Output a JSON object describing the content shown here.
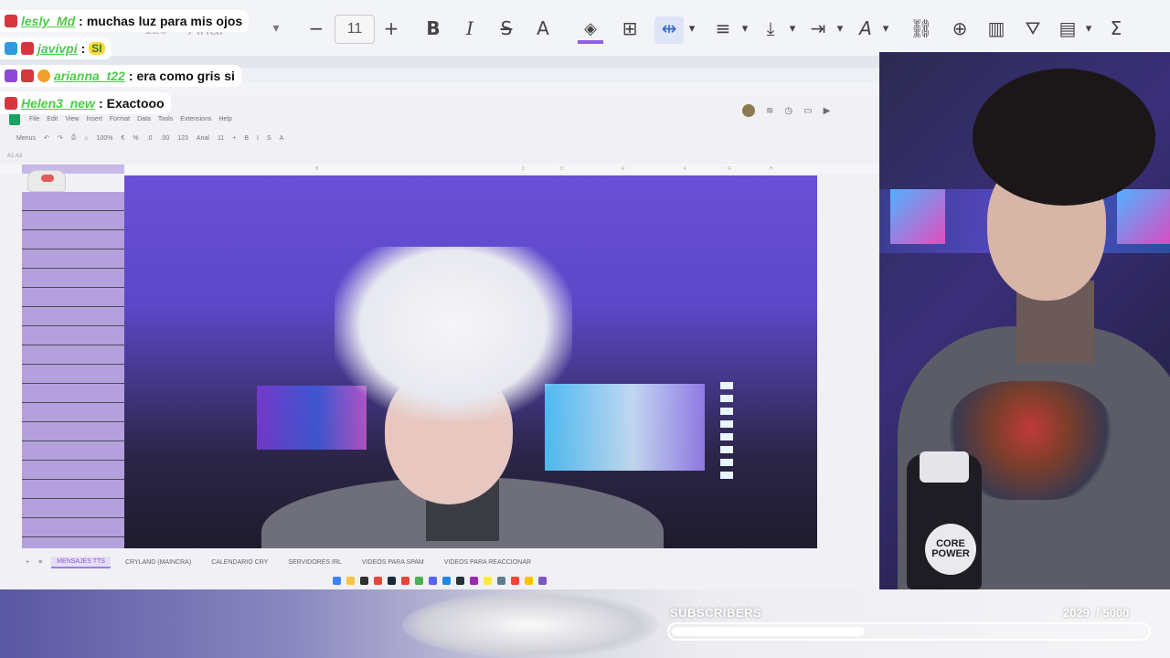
{
  "toolbar": {
    "zoom_partial": "120",
    "font_name": "Arial",
    "font_size": "11",
    "icons": [
      "minus-icon",
      "plus-icon",
      "bold-icon",
      "italic-icon",
      "strikethrough-icon",
      "text-color-icon",
      "fill-color-icon",
      "borders-icon",
      "merge-cells-icon",
      "horizontal-align-icon",
      "vertical-align-icon",
      "text-wrap-icon",
      "text-rotation-icon",
      "link-icon",
      "comment-icon",
      "chart-icon",
      "filter-icon",
      "table-view-icon",
      "functions-icon"
    ],
    "bold": "B",
    "italic": "I",
    "strike": "S",
    "text_color": "A",
    "rotate": "A",
    "sigma": "Σ",
    "accent": "#8e60e6"
  },
  "sheets": {
    "menu": [
      "File",
      "Edit",
      "View",
      "Insert",
      "Format",
      "Data",
      "Tools",
      "Extensions",
      "Help"
    ],
    "mini_toolbar": [
      "Menus",
      "↶",
      "↷",
      "⎙",
      "⌂",
      "100%",
      "€",
      "%",
      ".0",
      ".00",
      "123",
      "Arial",
      "11",
      "+",
      "B",
      "I",
      "S",
      "A"
    ],
    "cell_ref": "A1:A3",
    "col_labels": [
      "A",
      "B",
      "C",
      "D",
      "E",
      "F",
      "G",
      "H"
    ],
    "tabs": [
      {
        "label": "MENSAJES TTS",
        "active": true
      },
      {
        "label": "CRYLAND (MAINCRA)",
        "active": false
      },
      {
        "label": "CALENDARIO CRY",
        "active": false
      },
      {
        "label": "SERVIDORES IRL",
        "active": false
      },
      {
        "label": "VIDEOS PARA SPAM",
        "active": false
      },
      {
        "label": "VIDEOS PARA REACCIONAR",
        "active": false
      }
    ],
    "add_sheet": "+",
    "all_sheets": "≡"
  },
  "chat": [
    {
      "user": "lesly_Md",
      "sep": ":",
      "message": "muchas luz para mis ojos",
      "badges": [
        "red"
      ]
    },
    {
      "user": "javivpi",
      "sep": ":",
      "message": "",
      "emote": "SI",
      "badges": [
        "blue",
        "red"
      ]
    },
    {
      "user": "arianna_t22",
      "sep": ":",
      "message": "era como gris si",
      "badges": [
        "purple",
        "red",
        "orange"
      ]
    },
    {
      "user": "Helen3_new",
      "sep": ":",
      "message": "Exactooo",
      "badges": [
        "red"
      ]
    }
  ],
  "webcam": {
    "bottle_label_1": "CORE",
    "bottle_label_2": "POWER"
  },
  "subscribers": {
    "label": "SUBSCRIBERS",
    "current": "2029",
    "goal": "/ 5000",
    "progress_fraction": 0.4058
  }
}
